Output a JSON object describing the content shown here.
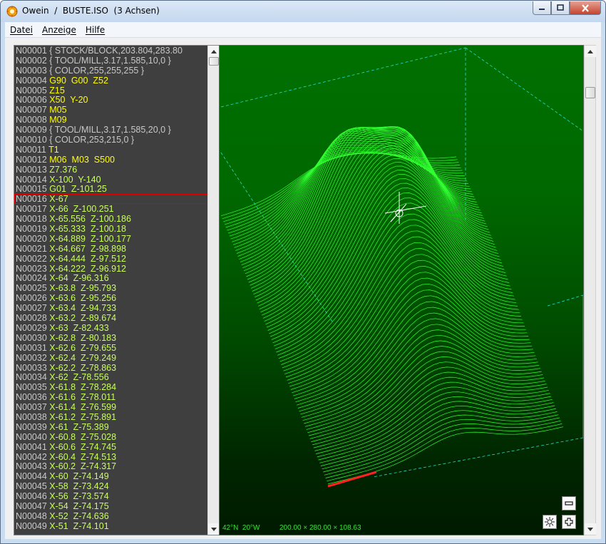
{
  "window": {
    "app_name": "Owein",
    "separator": "/",
    "file_name": "BUSTE.ISO",
    "axes": "(3 Achsen)"
  },
  "menu": {
    "items": [
      "Datei",
      "Anzeige",
      "Hilfe"
    ]
  },
  "code": {
    "selected_index": 15,
    "lines": [
      {
        "n": "N00001",
        "parts": [
          [
            "cmt",
            "{ STOCK/BLOCK,203.804,283.80"
          ]
        ]
      },
      {
        "n": "N00002",
        "parts": [
          [
            "cmt",
            "{ TOOL/MILL,3.17,1.585,10,0 }"
          ]
        ]
      },
      {
        "n": "N00003",
        "parts": [
          [
            "cmt",
            "{ COLOR,255,255,255 }"
          ]
        ]
      },
      {
        "n": "N00004",
        "parts": [
          [
            "kw",
            "G90  G00  Z52"
          ]
        ]
      },
      {
        "n": "N00005",
        "parts": [
          [
            "kw",
            "Z15"
          ]
        ]
      },
      {
        "n": "N00006",
        "parts": [
          [
            "kw",
            "X50  Y-20"
          ]
        ]
      },
      {
        "n": "N00007",
        "parts": [
          [
            "kw",
            "M05"
          ]
        ]
      },
      {
        "n": "N00008",
        "parts": [
          [
            "kw",
            "M09"
          ]
        ]
      },
      {
        "n": "N00009",
        "parts": [
          [
            "cmt",
            "{ TOOL/MILL,3.17,1.585,20,0 }"
          ]
        ]
      },
      {
        "n": "N00010",
        "parts": [
          [
            "cmt",
            "{ COLOR,253,215,0 }"
          ]
        ]
      },
      {
        "n": "N00011",
        "parts": [
          [
            "kw",
            "T1"
          ]
        ]
      },
      {
        "n": "N00012",
        "parts": [
          [
            "kw",
            "M06  M03  S500"
          ]
        ]
      },
      {
        "n": "N00013",
        "parts": [
          [
            "val",
            "Z7.376"
          ]
        ]
      },
      {
        "n": "N00014",
        "parts": [
          [
            "val",
            "X-100  Y-140"
          ]
        ]
      },
      {
        "n": "N00015",
        "parts": [
          [
            "val",
            "G01  Z-101.25"
          ]
        ]
      },
      {
        "n": "N00016",
        "parts": [
          [
            "val",
            "X-67"
          ]
        ]
      },
      {
        "n": "N00017",
        "parts": [
          [
            "val",
            "X-66  Z-100.251"
          ]
        ]
      },
      {
        "n": "N00018",
        "parts": [
          [
            "val",
            "X-65.556  Z-100.186"
          ]
        ]
      },
      {
        "n": "N00019",
        "parts": [
          [
            "val",
            "X-65.333  Z-100.18"
          ]
        ]
      },
      {
        "n": "N00020",
        "parts": [
          [
            "val",
            "X-64.889  Z-100.177"
          ]
        ]
      },
      {
        "n": "N00021",
        "parts": [
          [
            "val",
            "X-64.667  Z-98.898"
          ]
        ]
      },
      {
        "n": "N00022",
        "parts": [
          [
            "val",
            "X-64.444  Z-97.512"
          ]
        ]
      },
      {
        "n": "N00023",
        "parts": [
          [
            "val",
            "X-64.222  Z-96.912"
          ]
        ]
      },
      {
        "n": "N00024",
        "parts": [
          [
            "val",
            "X-64  Z-96.316"
          ]
        ]
      },
      {
        "n": "N00025",
        "parts": [
          [
            "val",
            "X-63.8  Z-95.793"
          ]
        ]
      },
      {
        "n": "N00026",
        "parts": [
          [
            "val",
            "X-63.6  Z-95.256"
          ]
        ]
      },
      {
        "n": "N00027",
        "parts": [
          [
            "val",
            "X-63.4  Z-94.733"
          ]
        ]
      },
      {
        "n": "N00028",
        "parts": [
          [
            "val",
            "X-63.2  Z-89.674"
          ]
        ]
      },
      {
        "n": "N00029",
        "parts": [
          [
            "val",
            "X-63  Z-82.433"
          ]
        ]
      },
      {
        "n": "N00030",
        "parts": [
          [
            "val",
            "X-62.8  Z-80.183"
          ]
        ]
      },
      {
        "n": "N00031",
        "parts": [
          [
            "val",
            "X-62.6  Z-79.655"
          ]
        ]
      },
      {
        "n": "N00032",
        "parts": [
          [
            "val",
            "X-62.4  Z-79.249"
          ]
        ]
      },
      {
        "n": "N00033",
        "parts": [
          [
            "val",
            "X-62.2  Z-78.863"
          ]
        ]
      },
      {
        "n": "N00034",
        "parts": [
          [
            "val",
            "X-62  Z-78.556"
          ]
        ]
      },
      {
        "n": "N00035",
        "parts": [
          [
            "val",
            "X-61.8  Z-78.284"
          ]
        ]
      },
      {
        "n": "N00036",
        "parts": [
          [
            "val",
            "X-61.6  Z-78.011"
          ]
        ]
      },
      {
        "n": "N00037",
        "parts": [
          [
            "val",
            "X-61.4  Z-76.599"
          ]
        ]
      },
      {
        "n": "N00038",
        "parts": [
          [
            "val",
            "X-61.2  Z-75.891"
          ]
        ]
      },
      {
        "n": "N00039",
        "parts": [
          [
            "val",
            "X-61  Z-75.389"
          ]
        ]
      },
      {
        "n": "N00040",
        "parts": [
          [
            "val",
            "X-60.8  Z-75.028"
          ]
        ]
      },
      {
        "n": "N00041",
        "parts": [
          [
            "val",
            "X-60.6  Z-74.745"
          ]
        ]
      },
      {
        "n": "N00042",
        "parts": [
          [
            "val",
            "X-60.4  Z-74.513"
          ]
        ]
      },
      {
        "n": "N00043",
        "parts": [
          [
            "val",
            "X-60.2  Z-74.317"
          ]
        ]
      },
      {
        "n": "N00044",
        "parts": [
          [
            "val",
            "X-60  Z-74.149"
          ]
        ]
      },
      {
        "n": "N00045",
        "parts": [
          [
            "val",
            "X-58  Z-73.424"
          ]
        ]
      },
      {
        "n": "N00046",
        "parts": [
          [
            "val",
            "X-56  Z-73.574"
          ]
        ]
      },
      {
        "n": "N00047",
        "parts": [
          [
            "val",
            "X-54  Z-74.175"
          ]
        ]
      },
      {
        "n": "N00048",
        "parts": [
          [
            "val",
            "X-52  Z-74.636"
          ]
        ]
      },
      {
        "n": "N00049",
        "parts": [
          [
            "val",
            "X-51  Z-74.101"
          ]
        ]
      }
    ]
  },
  "view": {
    "orientation": "42°N  20°W",
    "dimensions": "200.00 × 280.00 × 108.63"
  },
  "colors": {
    "code_bg": "#3f3f3f",
    "line_number": "#c8c8c8",
    "keyword": "#ffff00",
    "value": "#c8ff5a",
    "mesh": "#33ff33",
    "box": "#22ddcc",
    "toolpath": "#ff2020"
  },
  "icons": [
    "app-icon",
    "minimize-icon",
    "maximize-icon",
    "close-icon",
    "zoom-out-icon",
    "zoom-in-icon",
    "reset-view-icon",
    "crosshair-icon"
  ]
}
